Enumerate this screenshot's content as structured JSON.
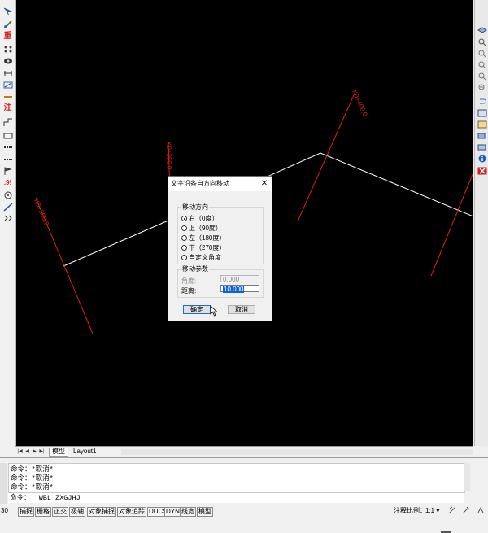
{
  "left_toolbar": {
    "icons": [
      "pointer-icon",
      "brush-icon",
      "text-zhong-icon",
      "dots-icon",
      "eye-icon",
      "ruler-icon",
      "measure-icon",
      "bar-icon",
      "annotation-zhu-icon",
      "polyline-icon",
      "rect-icon",
      "line-bar-icon",
      "line-bar2-icon",
      "flag-icon",
      "dot9-icon",
      "circle-icon",
      "line-icon",
      "wave-icon"
    ],
    "zhong_text": "重",
    "zhu_text": "注",
    "dot9_text": ".9!"
  },
  "right_toolbar": {
    "icons": [
      "layers-icon",
      "zoom-in-icon",
      "zoom-window-icon",
      "zoom-extent-icon",
      "zoom-icon",
      "zoom-out-icon",
      "undo-icon",
      "grid-icon",
      "grid2-icon",
      "layer-icon",
      "layer2-icon",
      "props-icon",
      "stack-icon",
      "info-icon",
      "delete-icon"
    ]
  },
  "canvas": {
    "labels": [
      "K0+300.0",
      "K0+350.0",
      "K0+400.0"
    ],
    "colors": {
      "background": "#000000",
      "line": "#ffffff",
      "section": "#e01e1e"
    }
  },
  "tabs": {
    "model": "模型",
    "layout": "Layout1"
  },
  "command": {
    "history": [
      "命令：*取消*",
      "命令：*取消*",
      "命令：*取消*"
    ],
    "prompt": "命令：  WBL_ZXGJHJ"
  },
  "status_bar": {
    "left_value": "30",
    "toggles": [
      "捕捉",
      "栅格",
      "正交",
      "极轴",
      "对象捕捉",
      "对象追踪",
      "DUCS",
      "DYN",
      "线宽",
      "模型"
    ],
    "scale_label": "注释比例：",
    "scale_value": "1:1 ▾"
  },
  "dialog": {
    "title": "文字沿各自方向移动",
    "close": "✕",
    "direction_group": "移动方向",
    "options": [
      "右（0度）",
      "上（90度）",
      "左（180度）",
      "下（270度）",
      "自定义角度"
    ],
    "selected_option": 0,
    "param_group": "移动参数",
    "angle_label": "角度:",
    "angle_value": "0.000",
    "distance_label": "距离:",
    "distance_value": "10.000",
    "ok_label": "确定",
    "cancel_label": "取消"
  }
}
